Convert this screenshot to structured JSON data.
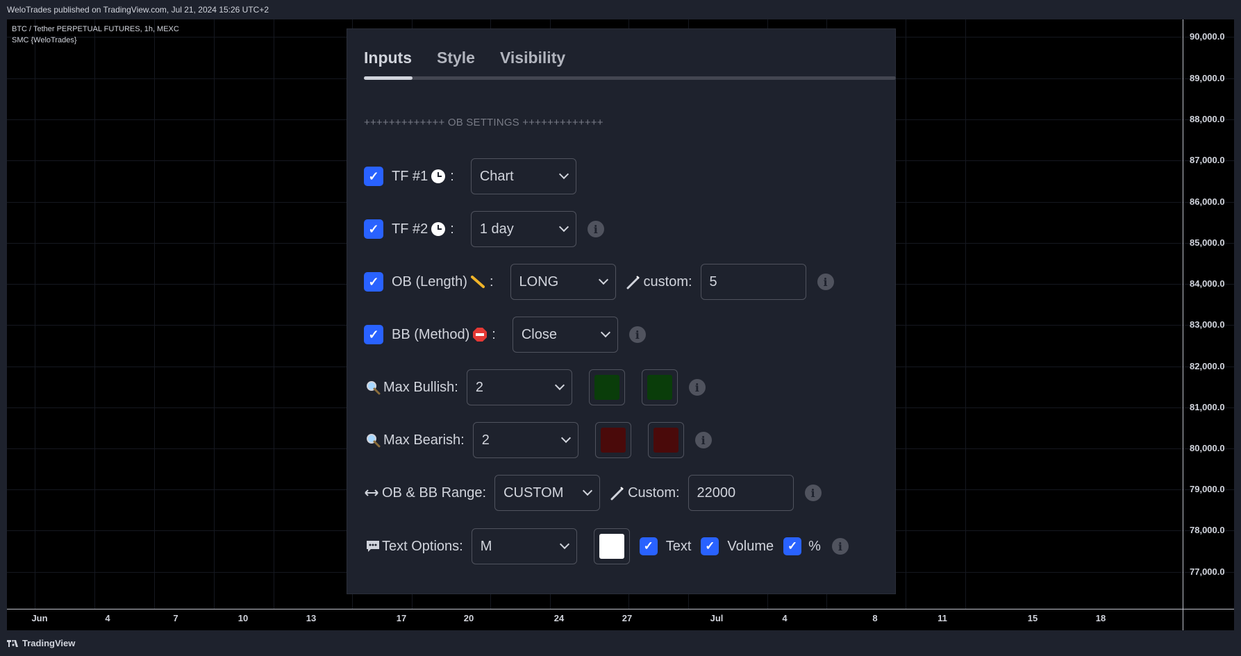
{
  "header": {
    "publish_text": "WeloTrades published on TradingView.com, Jul 21, 2024 15:26 UTC+2"
  },
  "chart": {
    "symbol_line": "BTC / Tether PERPETUAL FUTURES, 1h, MEXC",
    "indicator_line": "SMC {WeloTrades}",
    "price_labels": [
      "90,000.0",
      "89,000.0",
      "88,000.0",
      "87,000.0",
      "86,000.0",
      "85,000.0",
      "84,000.0",
      "83,000.0",
      "82,000.0",
      "81,000.0",
      "80,000.0",
      "79,000.0",
      "78,000.0",
      "77,000.0"
    ],
    "date_labels": [
      "Jun",
      "4",
      "7",
      "10",
      "13",
      "17",
      "20",
      "24",
      "27",
      "Jul",
      "4",
      "8",
      "11",
      "15",
      "18"
    ]
  },
  "footer": {
    "brand": "TradingView"
  },
  "dialog": {
    "tabs": [
      {
        "label": "Inputs",
        "active": true
      },
      {
        "label": "Style",
        "active": false
      },
      {
        "label": "Visibility",
        "active": false
      }
    ],
    "section_title": "+++++++++++++ OB SETTINGS +++++++++++++",
    "rows": {
      "tf1": {
        "checked": true,
        "label": "TF #1",
        "suffix": ":",
        "value": "Chart"
      },
      "tf2": {
        "checked": true,
        "label": "TF #2",
        "suffix": ":",
        "value": "1 day"
      },
      "ob_length": {
        "checked": true,
        "label": "OB (Length)",
        "suffix": ":",
        "value": "LONG",
        "custom_label": "custom:",
        "custom_value": "5"
      },
      "bb_method": {
        "checked": true,
        "label": "BB (Method)",
        "suffix": ":",
        "value": "Close"
      },
      "max_bullish": {
        "label": "Max Bullish:",
        "value": "2",
        "color1": "#0a3d0a",
        "color2": "#0a3d0a"
      },
      "max_bearish": {
        "label": "Max Bearish:",
        "value": "2",
        "color1": "#4a0a0a",
        "color2": "#4a0a0a"
      },
      "range": {
        "label": "OB & BB Range:",
        "value": "CUSTOM",
        "custom_label": "Custom:",
        "custom_value": "22000"
      },
      "text_options": {
        "label": "Text Options:",
        "value": "M",
        "color": "#ffffff",
        "text_label": "Text",
        "volume_label": "Volume",
        "percent_label": "%"
      }
    }
  },
  "icons": {
    "checkbox": "check-icon",
    "info": "info-icon",
    "clock": "clock-icon",
    "ruler": "ruler-icon",
    "stop": "stop-sign-icon",
    "magnifier": "magnifier-icon",
    "arrows": "left-right-arrow-icon",
    "speech": "speech-bubble-icon",
    "wand": "wand-icon"
  }
}
